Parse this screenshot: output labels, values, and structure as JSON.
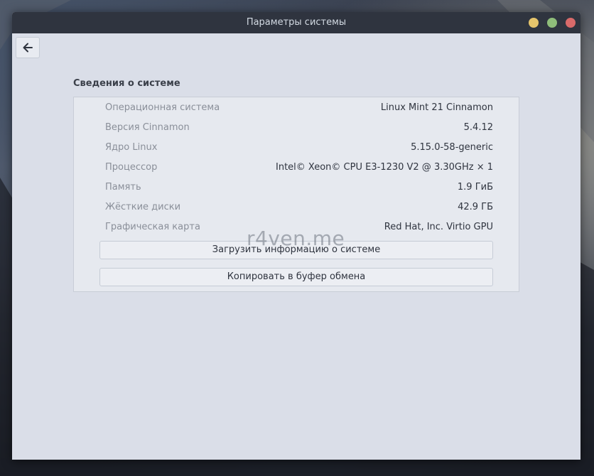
{
  "window": {
    "title": "Параметры системы"
  },
  "section": {
    "title": "Сведения о системе"
  },
  "info_rows": [
    {
      "label": "Операционная система",
      "value": "Linux Mint 21 Cinnamon"
    },
    {
      "label": "Версия Cinnamon",
      "value": "5.4.12"
    },
    {
      "label": "Ядро Linux",
      "value": "5.15.0-58-generic"
    },
    {
      "label": "Процессор",
      "value": "Intel© Xeon© CPU E3-1230 V2 @ 3.30GHz × 1"
    },
    {
      "label": "Память",
      "value": "1.9 ГиБ"
    },
    {
      "label": "Жёсткие диски",
      "value": "42.9 ГБ"
    },
    {
      "label": "Графическая карта",
      "value": "Red Hat, Inc. Virtio GPU"
    }
  ],
  "buttons": {
    "upload": "Загрузить информацию о системе",
    "copy": "Копировать в буфер обмена"
  },
  "watermark": "r4ven.me",
  "icons": {
    "back": "arrow-left-icon"
  },
  "colors": {
    "titlebar": "#2f343f",
    "window_bg": "#dadee8",
    "minimize": "#e6c56c",
    "maximize": "#8fbd7a",
    "close": "#d96a6a"
  }
}
